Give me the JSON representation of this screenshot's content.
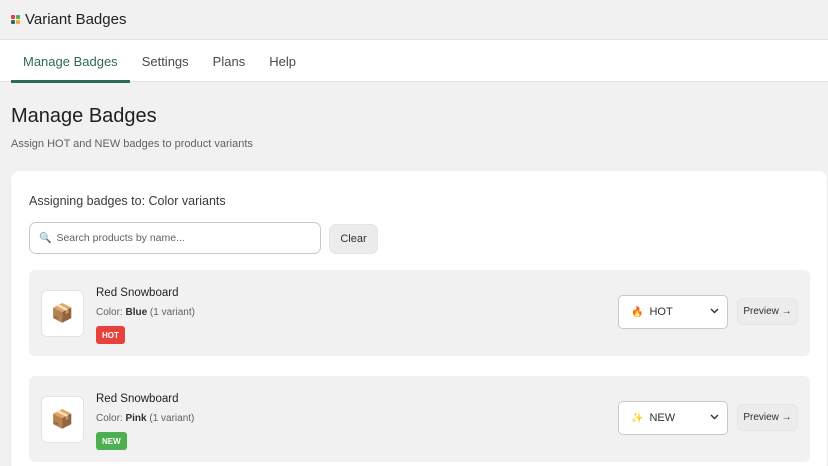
{
  "app": {
    "title": "Variant Badges",
    "logo_colors": [
      "#e5423b",
      "#4caf50",
      "#2d6a5a",
      "#f2a93b"
    ]
  },
  "tabs": [
    {
      "label": "Manage Badges",
      "active": true
    },
    {
      "label": "Settings",
      "active": false
    },
    {
      "label": "Plans",
      "active": false
    },
    {
      "label": "Help",
      "active": false
    }
  ],
  "page": {
    "title": "Manage Badges",
    "subtitle": "Assign HOT and NEW badges to product variants"
  },
  "assign": {
    "label": "Assigning badges to: Color variants"
  },
  "search": {
    "icon": "search-icon",
    "placeholder": "Search products by name...",
    "value": "",
    "clear_label": "Clear"
  },
  "rows": [
    {
      "product_name": "Red Snowboard",
      "option_label": "Color:",
      "option_value": "Blue",
      "variant_count": "(1 variant)",
      "badge": "HOT",
      "badge_color": "#e5423b",
      "select_icon": "🔥",
      "select_value": "HOT",
      "preview_label": "Preview →",
      "thumb_icon": "📦"
    },
    {
      "product_name": "Red Snowboard",
      "option_label": "Color:",
      "option_value": "Pink",
      "variant_count": "(1 variant)",
      "badge": "NEW",
      "badge_color": "#4caf50",
      "select_icon": "✨",
      "select_value": "NEW",
      "preview_label": "Preview →",
      "thumb_icon": "📦"
    }
  ],
  "colors": {
    "accent": "#2d6a5a",
    "hot": "#e5423b",
    "new": "#4caf50"
  }
}
